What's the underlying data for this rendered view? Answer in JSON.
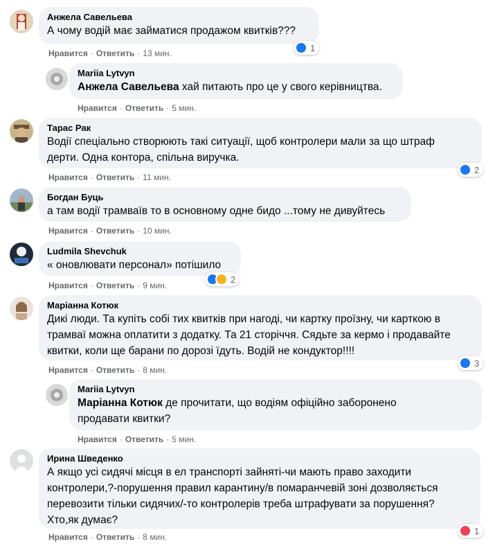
{
  "labels": {
    "like": "Нравится",
    "reply": "Ответить",
    "dot": "·"
  },
  "comments": [
    {
      "author": "Анжела Савельева",
      "text": "А чому водій має займатися продажом квитків???",
      "time": "13 мин.",
      "reactions": "1"
    },
    {
      "author": "Mariia Lytvyn",
      "mention": "Анжела Савельева",
      "text": " хай питають про це у свого керівництва.",
      "time": "5 мин."
    },
    {
      "author": "Тарас Рак",
      "line1": "Водії спеціально створюють такі ситуації, щоб контролери мали за що штраф",
      "line2": "дерти. Одна контора, спільна виручка.",
      "time": "11 мин.",
      "reactions": "2"
    },
    {
      "author": "Богдан Буць",
      "text": "а там водії трамваїв то в основному одне бидо ...тому не дивуйтесь",
      "time": "10 мин."
    },
    {
      "author": "Ludmila Shevchuk",
      "text": "« оновлювати персонал» потішило",
      "time": "9 мин.",
      "reactions": "2"
    },
    {
      "author": "Маріанна Котюк",
      "line1": "Дикі люди. Та купіть собі тих квитків при нагоді, чи картку проїзну, чи карткою в",
      "line2": "трамваї можна оплатити з додатку. Та 21 сторіччя. Сядьте за кермо і продавайте",
      "line3": "квитки, коли ще барани по дорозі їдуть. Водій не кондуктор!!!!",
      "time": "8 мин.",
      "reactions": "3"
    },
    {
      "author": "Mariia Lytvyn",
      "mention": "Маріанна Котюк",
      "line1": " де прочитати, що водіям офіційно заборонено",
      "line2": "продавати квитки?",
      "time": "5 мин."
    },
    {
      "author": "Ирина Шведенко",
      "line1": "А якщо усі сидячі місця в ел транспорті зайняті-чи мають право заходити",
      "line2": "контролери,?-порушення правил карантину/в помаранчевій зоні дозволяється",
      "line3": "перевозити тільки сидячих/-то контролерів треба штрафувати за порушення?",
      "line4": "Хто,як думає?",
      "time": "8 мин.",
      "reactions": "1"
    }
  ],
  "colors": {
    "bubble": "#f0f2f5",
    "meta": "#65676b",
    "like": "#1877f2",
    "haha": "#f7b125",
    "love": "#f33e58"
  }
}
